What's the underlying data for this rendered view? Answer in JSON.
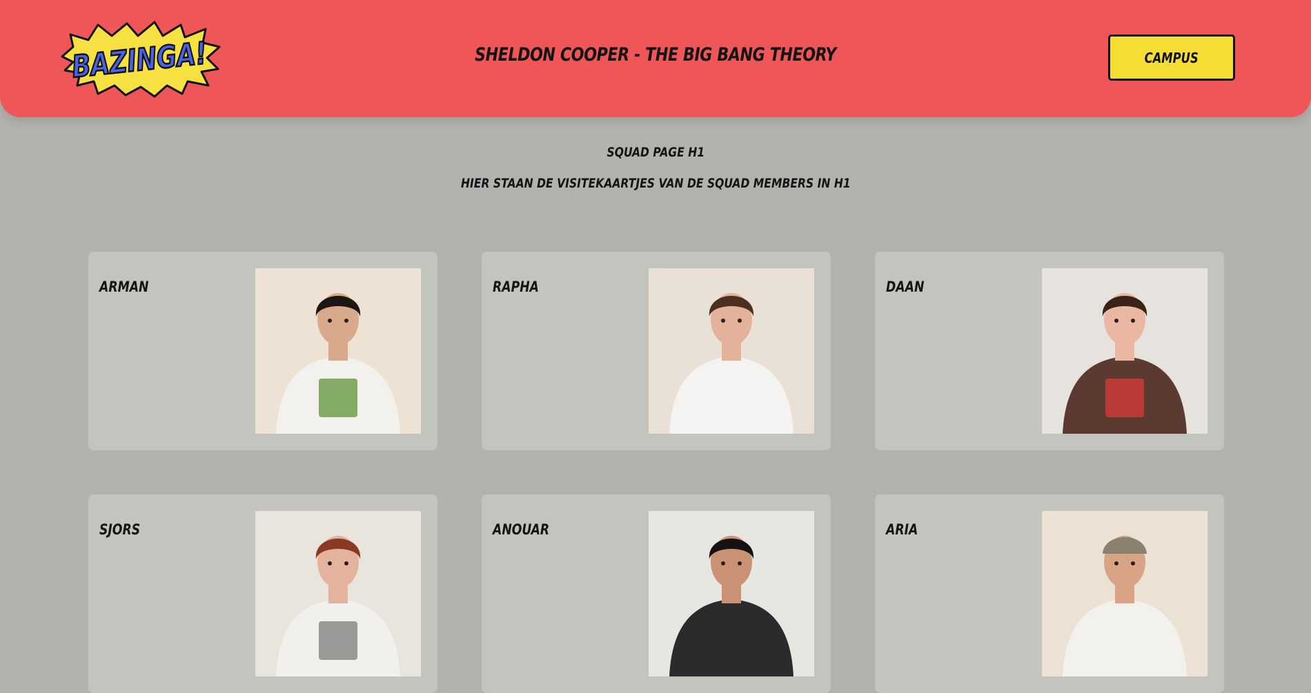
{
  "header": {
    "logo_text": "BAZINGA!",
    "title": "Sheldon Cooper - The Big Bang Theory",
    "campus_button": "Campus"
  },
  "intro": {
    "line1": "Squad page H1",
    "line2": "Hier staan de visitekaartjes van de squad members in H1"
  },
  "members": [
    {
      "name": "Arman",
      "photo_bg": "#ede2d3",
      "hair": "#1c1714",
      "skin": "#d9a98c",
      "shirt": "#f3f1ee",
      "print": "#6f9f4c"
    },
    {
      "name": "Rapha",
      "photo_bg": "#e9e1d6",
      "hair": "#4d2f22",
      "skin": "#e2b39a",
      "shirt": "#f4f3f1",
      "print": ""
    },
    {
      "name": "Daan",
      "photo_bg": "#e6e2de",
      "hair": "#3a2219",
      "skin": "#eab7a2",
      "shirt": "#5c3a31",
      "print": "#c93b38"
    },
    {
      "name": "Sjors",
      "photo_bg": "#e9e5dc",
      "hair": "#8a3a24",
      "skin": "#e4b39d",
      "shirt": "#f2f0ec",
      "print": "#8a8a8a"
    },
    {
      "name": "Anouar",
      "photo_bg": "#e8e6e1",
      "hair": "#141212",
      "skin": "#c99274",
      "shirt": "#2b2b2d",
      "print": ""
    },
    {
      "name": "Aria",
      "photo_bg": "#ebe2d4",
      "hair": "#2a1c16",
      "skin": "#d9a386",
      "shirt": "#f3f1ee",
      "print": "",
      "cap": "#8b8171"
    }
  ]
}
